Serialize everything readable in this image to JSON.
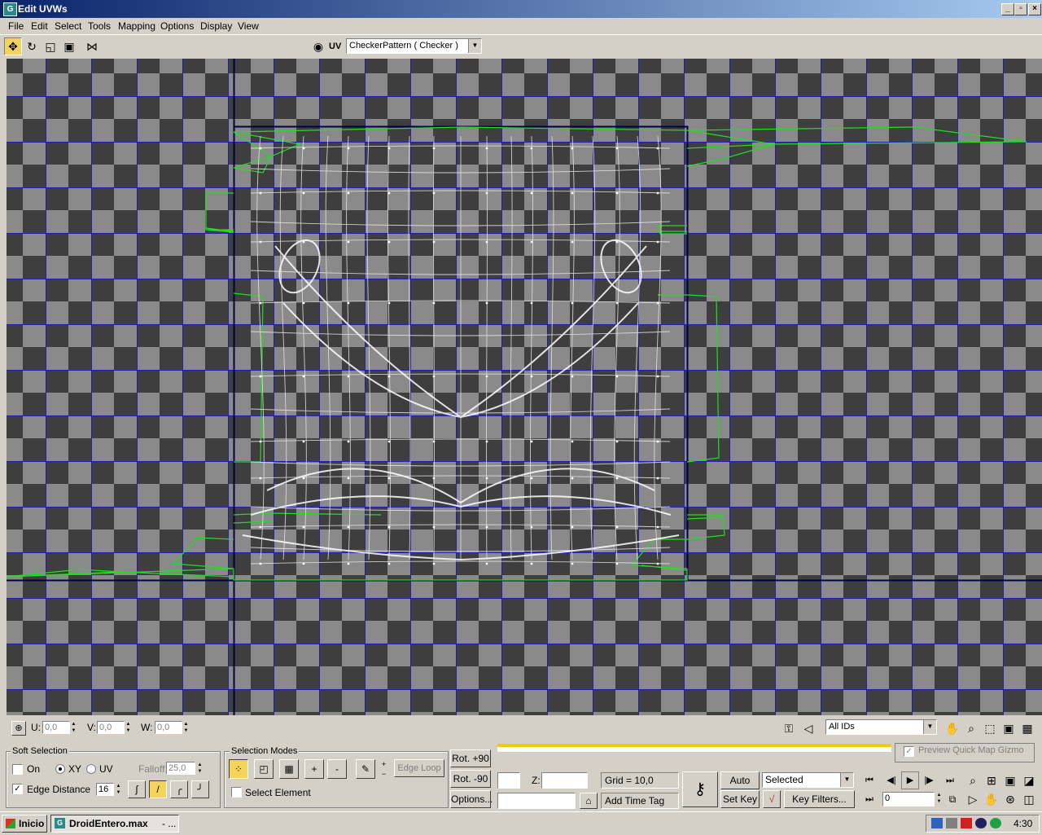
{
  "window": {
    "title": "Edit UVWs"
  },
  "menu": [
    "File",
    "Edit",
    "Select",
    "Tools",
    "Mapping",
    "Options",
    "Display",
    "View"
  ],
  "toolbar": {
    "uv_label": "UV",
    "map_select": "CheckerPattern  ( Checker )"
  },
  "coords": {
    "u_label": "U:",
    "u_value": "0,0",
    "v_label": "V:",
    "v_value": "0,0",
    "w_label": "W:",
    "w_value": "0,0",
    "ids_select": "All IDs"
  },
  "soft_selection": {
    "title": "Soft Selection",
    "on_label": "On",
    "xy_label": "XY",
    "uv_label": "UV",
    "falloff_label": "Falloff:",
    "falloff_value": "25,0",
    "edge_distance_label": "Edge Distance",
    "edge_distance_value": "16"
  },
  "selection_modes": {
    "title": "Selection Modes",
    "plus": "+",
    "minus": "-",
    "edge_loop": "Edge Loop",
    "select_element": "Select Element"
  },
  "rotation": {
    "rot_plus": "Rot. +90",
    "rot_minus": "Rot. -90",
    "options": "Options..."
  },
  "preview_quick_map": "Preview Quick Map Gizmo",
  "status": {
    "z_label": "Z:",
    "grid": "Grid = 10,0",
    "add_time_tag": "Add Time Tag"
  },
  "animation": {
    "auto_key": "Auto Key",
    "set_key": "Set Key",
    "selected": "Selected",
    "key_filters": "Key Filters...",
    "frame": "0"
  },
  "taskbar": {
    "start": "Inicio",
    "task": "DroidEntero.max",
    "task_suffix": "- ...",
    "clock": "4:30"
  },
  "colors": {
    "accent_yellow": "#f5d35a",
    "grid_blue": "#1a1ab4",
    "uv_edge_white": "#ffffff",
    "uv_border_green": "#22dd22"
  }
}
